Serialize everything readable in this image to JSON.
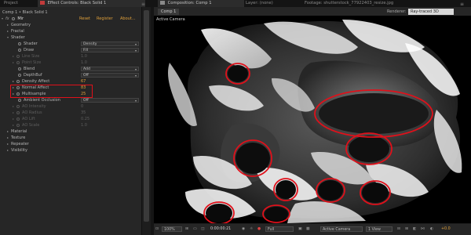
{
  "top_tabs": [
    {
      "label": "Project"
    },
    {
      "label": "Effect Controls: Black Solid 1"
    },
    {
      "label": "Composition: Comp 1"
    },
    {
      "label": "Layer: (none)"
    },
    {
      "label": "Footage: shutterstock_77922403_resize.jpg"
    }
  ],
  "effect_controls": {
    "layer_name": "Comp 1 • Black Solid 1",
    "effect_name": "Mir",
    "reset": "Reset",
    "register": "Register",
    "about": "About...",
    "rows": {
      "geometry": "Geometry",
      "fractal": "Fractal",
      "shader": "Shader",
      "shader_sub": "Shader",
      "shader_val": "Density",
      "draw": "Draw",
      "draw_val": "Fill",
      "line_size": "Line Size",
      "line_size_val": "1.0",
      "point_size": "Point Size",
      "point_size_val": "1.0",
      "blend": "Blend",
      "blend_val": "Add",
      "depthbuf": "DepthBuf",
      "depthbuf_val": "Off",
      "density_affect": "Density Affect",
      "density_affect_val": "67",
      "normal_affect": "Normal Affect",
      "normal_affect_val": "83",
      "multisample": "Multisample",
      "multisample_val": "25",
      "ambient_occlusion": "Ambient Occlusion",
      "ambient_occlusion_val": "Off",
      "ao_intensity": "AO Intensity",
      "ao_intensity_val": "0",
      "ao_radius": "AO Radius",
      "ao_radius_val": "35",
      "ao_lift": "AO Lift",
      "ao_lift_val": "0.25",
      "ao_scale": "AO Scale",
      "ao_scale_val": "1.0",
      "material": "Material",
      "texture": "Texture",
      "repeater": "Repeater",
      "visibility": "Visibility"
    }
  },
  "composition": {
    "tab": "Comp 1",
    "renderer_label": "Renderer:",
    "renderer_value": "Ray-traced 3D",
    "camera_label": "Active Camera"
  },
  "bottom_bar": {
    "zoom": "100%",
    "timecode": "0:00:00:21",
    "resolution": "Full",
    "view": "Active Camera",
    "views": "1 View",
    "exposure": "+0.0"
  },
  "colors": {
    "accent_orange": "#e0a03a",
    "annotation_red": "#e0101a",
    "panel_bg": "#262626"
  }
}
